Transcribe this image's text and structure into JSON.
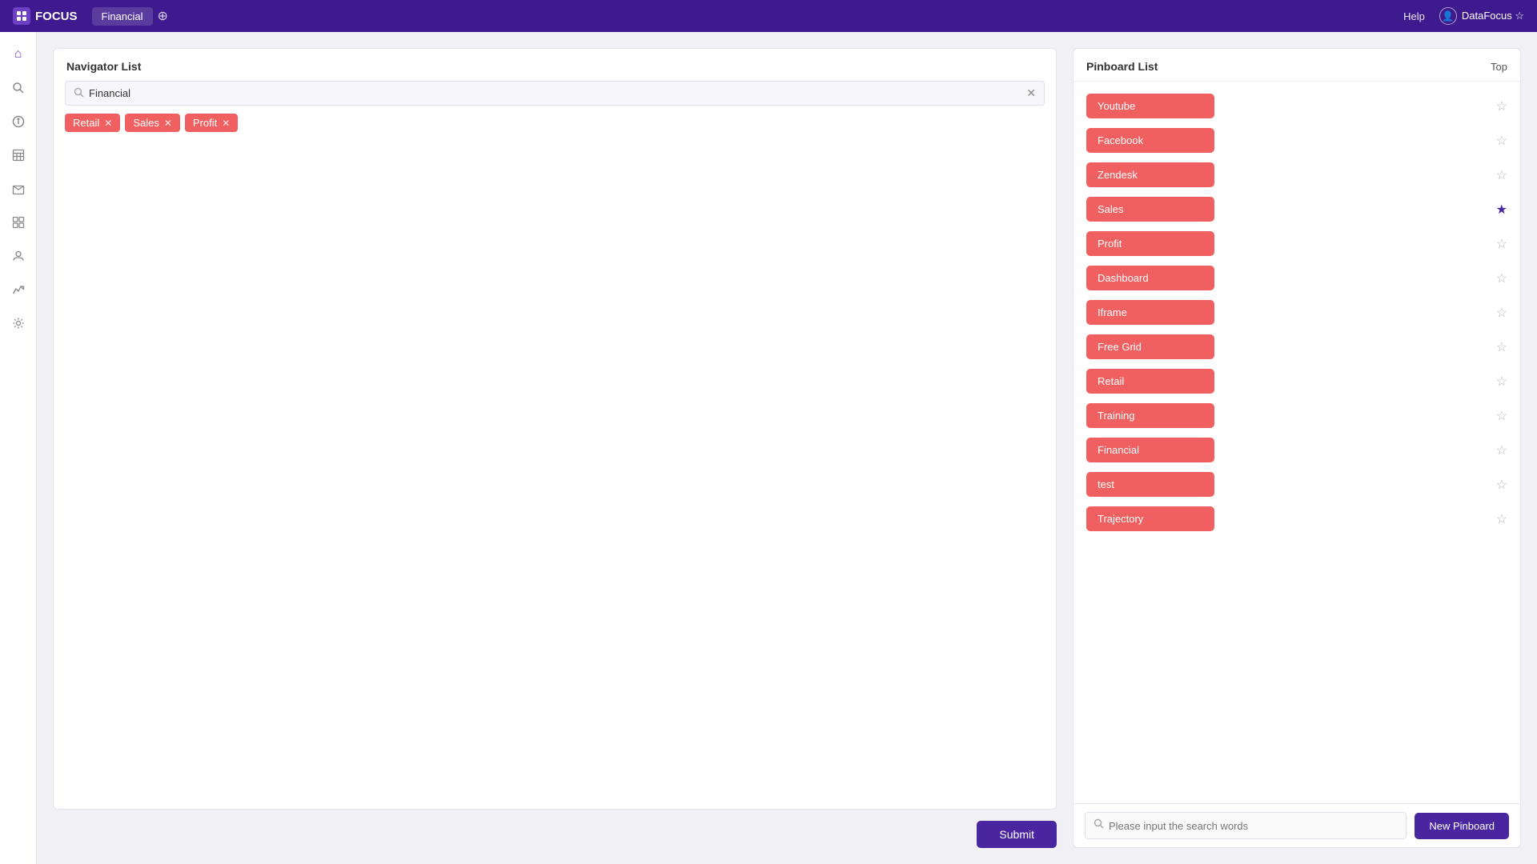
{
  "app": {
    "logo_text": "FOCUS",
    "tab_label": "Financial",
    "help_label": "Help",
    "user_label": "DataFocus ☆"
  },
  "sidebar": {
    "items": [
      {
        "name": "home",
        "icon": "⌂"
      },
      {
        "name": "search",
        "icon": "⌕"
      },
      {
        "name": "info",
        "icon": "ℹ"
      },
      {
        "name": "table",
        "icon": "▦"
      },
      {
        "name": "inbox",
        "icon": "⊡"
      },
      {
        "name": "data",
        "icon": "⊞"
      },
      {
        "name": "user",
        "icon": "👤"
      },
      {
        "name": "analytics",
        "icon": "⤴"
      },
      {
        "name": "settings",
        "icon": "⚙"
      }
    ]
  },
  "navigator": {
    "title": "Navigator List",
    "search_value": "Financial",
    "tags": [
      {
        "label": "Retail"
      },
      {
        "label": "Sales"
      },
      {
        "label": "Profit"
      }
    ],
    "submit_label": "Submit"
  },
  "pinboard": {
    "title": "Pinboard List",
    "top_label": "Top",
    "items": [
      {
        "label": "Youtube",
        "starred": false
      },
      {
        "label": "Facebook",
        "starred": false
      },
      {
        "label": "Zendesk",
        "starred": false
      },
      {
        "label": "Sales",
        "starred": true
      },
      {
        "label": "Profit",
        "starred": false
      },
      {
        "label": "Dashboard",
        "starred": false
      },
      {
        "label": "Iframe",
        "starred": false
      },
      {
        "label": "Free Grid",
        "starred": false
      },
      {
        "label": "Retail",
        "starred": false
      },
      {
        "label": "Training",
        "starred": false
      },
      {
        "label": "Financial",
        "starred": false
      },
      {
        "label": "test",
        "starred": false
      },
      {
        "label": "Trajectory",
        "starred": false
      }
    ],
    "search_placeholder": "Please input the search words",
    "new_pinboard_label": "New Pinboard"
  }
}
